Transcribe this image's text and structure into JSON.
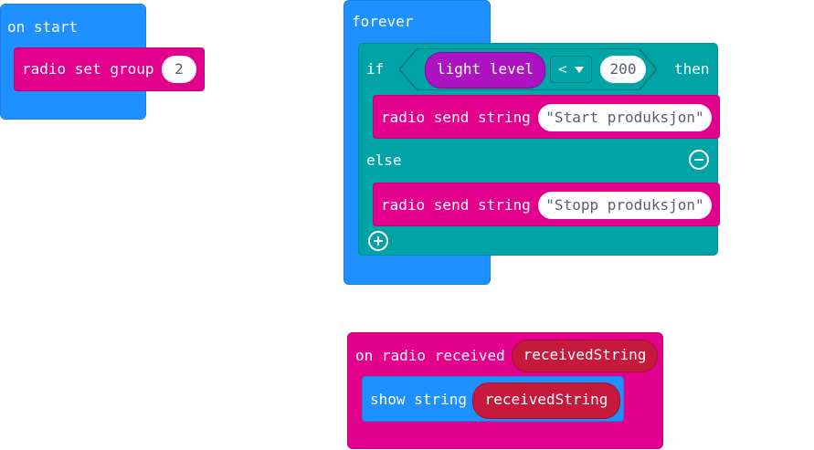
{
  "on_start": {
    "hat_label": "on start",
    "radio_set_group_label": "radio set group",
    "group_value": "2"
  },
  "forever": {
    "hat_label": "forever",
    "if_label": "if",
    "light_level_label": "light level",
    "operator": "<",
    "threshold": "200",
    "then_label": "then",
    "send_string_label_1": "radio send string",
    "string_1": "\"Start produksjon\"",
    "else_label": "else",
    "send_string_label_2": "radio send string",
    "string_2": "\"Stopp produksjon\""
  },
  "on_radio_received": {
    "hat_label": "on radio received",
    "param": "receivedString",
    "show_string_label": "show string",
    "show_arg": "receivedString"
  },
  "colors": {
    "basic_blue": "#1e90ff",
    "radio_pink": "#e3008c",
    "logic_teal": "#00a4a6",
    "input_purple": "#ae13c2",
    "variable_red": "#c51a3c"
  }
}
